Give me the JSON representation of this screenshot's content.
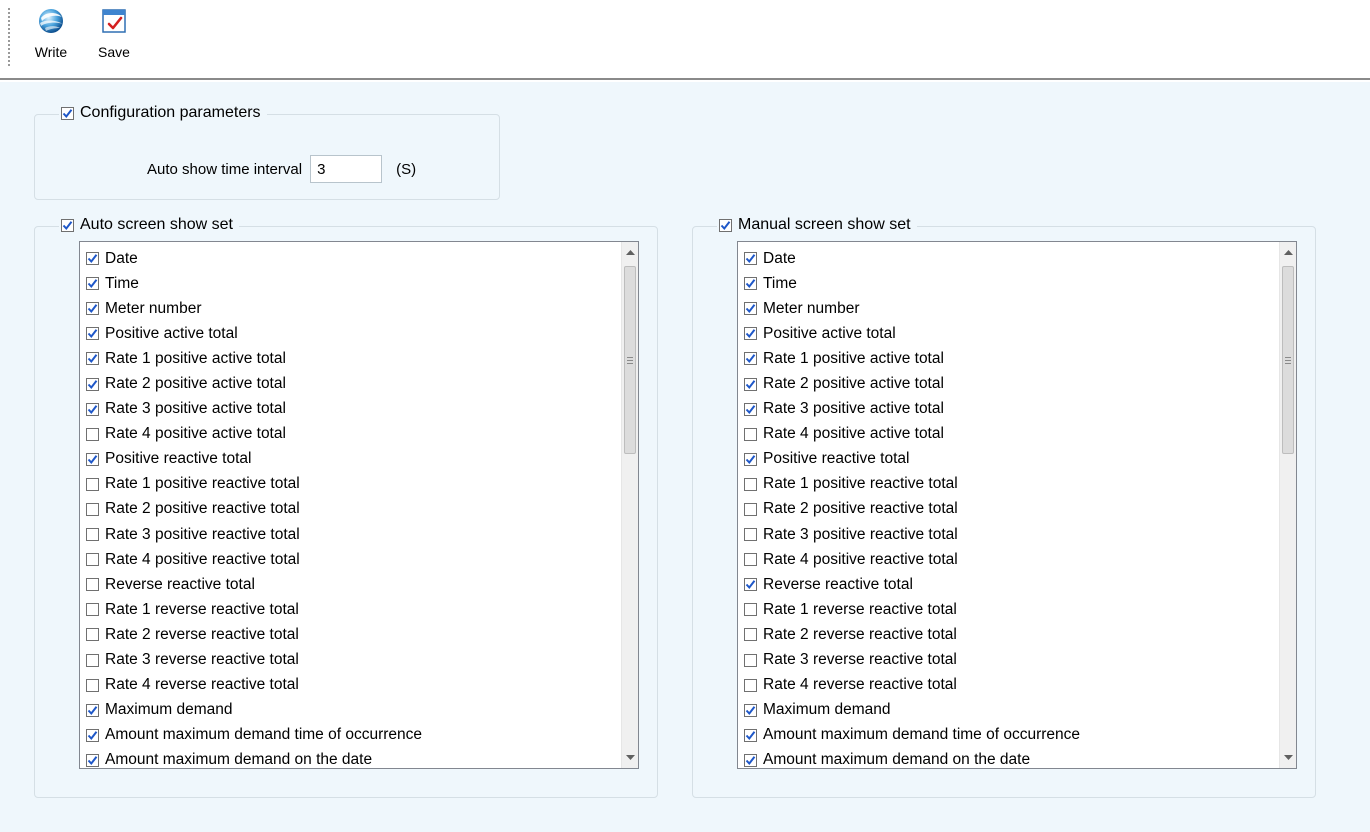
{
  "toolbar": {
    "write_label": "Write",
    "save_label": "Save"
  },
  "config_group": {
    "title": "Configuration parameters",
    "checked": true,
    "interval_label": "Auto show time interval",
    "interval_value": "3",
    "interval_unit": "(S)"
  },
  "auto_group": {
    "title": "Auto screen show set",
    "checked": true,
    "items": [
      {
        "label": "Date",
        "checked": true
      },
      {
        "label": "Time",
        "checked": true
      },
      {
        "label": "Meter number",
        "checked": true
      },
      {
        "label": "Positive active total",
        "checked": true
      },
      {
        "label": "Rate 1 positive active total",
        "checked": true
      },
      {
        "label": "Rate 2 positive active total",
        "checked": true
      },
      {
        "label": "Rate 3 positive active total",
        "checked": true
      },
      {
        "label": "Rate 4 positive active total",
        "checked": false
      },
      {
        "label": "Positive reactive total",
        "checked": true
      },
      {
        "label": "Rate 1 positive reactive total",
        "checked": false
      },
      {
        "label": "Rate 2 positive reactive total",
        "checked": false
      },
      {
        "label": "Rate 3 positive reactive total",
        "checked": false
      },
      {
        "label": "Rate 4 positive reactive total",
        "checked": false
      },
      {
        "label": "Reverse reactive total",
        "checked": false
      },
      {
        "label": "Rate 1 reverse reactive total",
        "checked": false
      },
      {
        "label": "Rate 2 reverse reactive total",
        "checked": false
      },
      {
        "label": "Rate 3 reverse reactive total",
        "checked": false
      },
      {
        "label": "Rate 4 reverse reactive total",
        "checked": false
      },
      {
        "label": "Maximum demand",
        "checked": true
      },
      {
        "label": "Amount maximum demand time of occurrence",
        "checked": true
      },
      {
        "label": "Amount maximum demand on the date",
        "checked": true
      }
    ]
  },
  "manual_group": {
    "title": "Manual screen show set",
    "checked": true,
    "items": [
      {
        "label": "Date",
        "checked": true
      },
      {
        "label": "Time",
        "checked": true
      },
      {
        "label": "Meter number",
        "checked": true
      },
      {
        "label": "Positive active total",
        "checked": true
      },
      {
        "label": "Rate 1 positive active total",
        "checked": true
      },
      {
        "label": "Rate 2 positive active total",
        "checked": true
      },
      {
        "label": "Rate 3 positive active total",
        "checked": true
      },
      {
        "label": "Rate 4 positive active total",
        "checked": false
      },
      {
        "label": "Positive reactive total",
        "checked": true
      },
      {
        "label": "Rate 1 positive reactive total",
        "checked": false
      },
      {
        "label": "Rate 2 positive reactive total",
        "checked": false
      },
      {
        "label": "Rate 3 positive reactive total",
        "checked": false
      },
      {
        "label": "Rate 4 positive reactive total",
        "checked": false
      },
      {
        "label": "Reverse reactive total",
        "checked": true
      },
      {
        "label": "Rate 1 reverse reactive total",
        "checked": false
      },
      {
        "label": "Rate 2 reverse reactive total",
        "checked": false
      },
      {
        "label": "Rate 3 reverse reactive total",
        "checked": false
      },
      {
        "label": "Rate 4 reverse reactive total",
        "checked": false
      },
      {
        "label": "Maximum demand",
        "checked": true
      },
      {
        "label": "Amount maximum demand time of occurrence",
        "checked": true
      },
      {
        "label": "Amount maximum demand on the date",
        "checked": true
      }
    ]
  },
  "colors": {
    "panel_background": "#eff7fc",
    "check_mark": "#1e57c8"
  },
  "icons": {
    "write": "globe-write-icon",
    "save": "save-document-icon"
  }
}
